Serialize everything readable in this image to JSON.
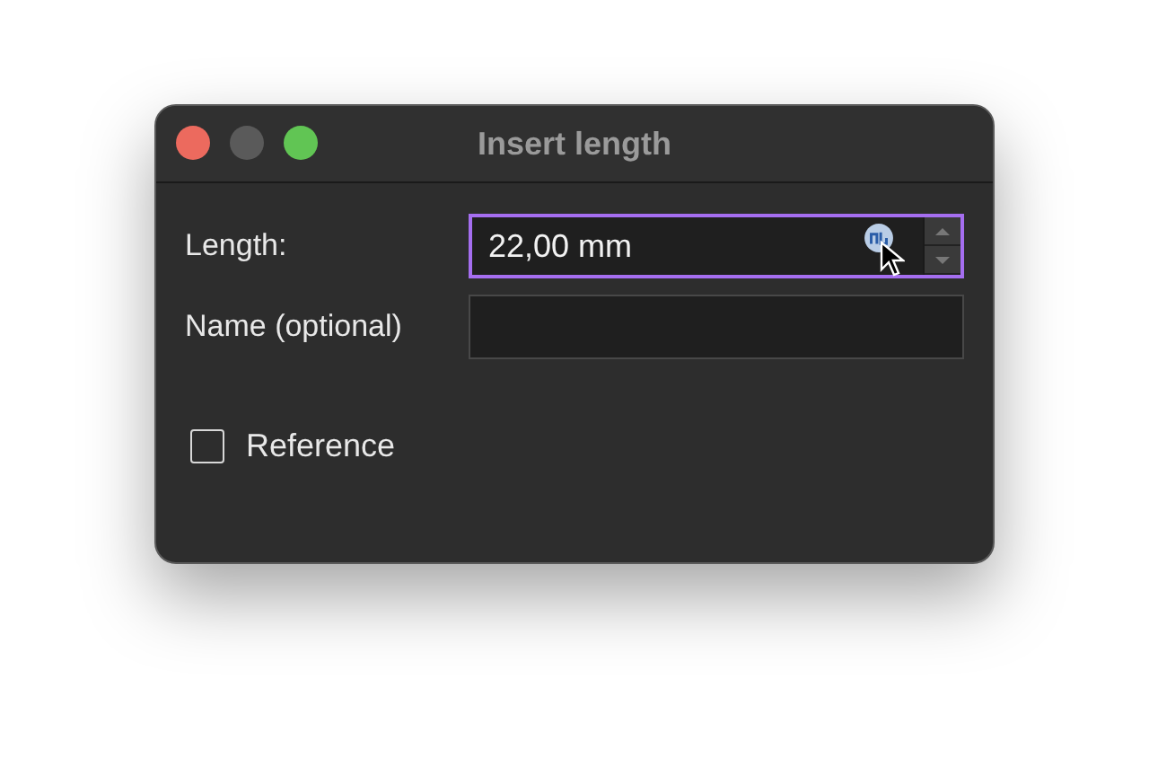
{
  "window": {
    "title": "Insert length"
  },
  "fields": [
    {
      "label": "Length:",
      "value": "22,00 mm",
      "focused": true,
      "kind": "spin"
    },
    {
      "label": "Name (optional)",
      "focused": false,
      "kind": "text"
    }
  ],
  "checkbox": {
    "label": "Reference",
    "checked": false
  }
}
